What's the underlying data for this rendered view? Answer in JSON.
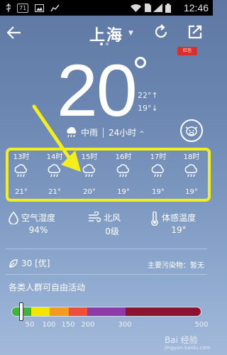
{
  "status_bar": {
    "notification_badge": "71",
    "time": "12:46",
    "icons": [
      "usb-icon",
      "notification-71",
      "image-icon",
      "chart-icon",
      "wifi-icon",
      "sd-card-icon",
      "signal-icon",
      "battery-icon"
    ]
  },
  "header": {
    "back_icon": "arrow-left-icon",
    "city": "上海",
    "dropdown_icon": "caret-down-icon",
    "refresh_icon": "refresh-icon",
    "share_icon": "share-icon",
    "badge_text": "红包"
  },
  "current": {
    "temperature": "20",
    "high": "22°↑",
    "low": "19°↓",
    "condition": "中雨",
    "forecast_toggle": "24小时",
    "mascot_icon": "cow-mascot-icon"
  },
  "hourly": [
    {
      "time": "13时",
      "temp": "21°",
      "icon": "rain-icon"
    },
    {
      "time": "14时",
      "temp": "21°",
      "icon": "rain-icon"
    },
    {
      "time": "15时",
      "temp": "20°",
      "icon": "rain-icon"
    },
    {
      "time": "16时",
      "temp": "19°",
      "icon": "rain-icon"
    },
    {
      "time": "17时",
      "temp": "19°",
      "icon": "rain-icon"
    },
    {
      "time": "18时",
      "temp": "19°",
      "icon": "rain-icon"
    }
  ],
  "details": {
    "humidity": {
      "label": "空气湿度",
      "value": "94%",
      "icon": "droplet-icon"
    },
    "wind": {
      "label": "北风",
      "value": "0级",
      "icon": "wind-icon"
    },
    "feels_like": {
      "label": "体感温度",
      "value": "19°",
      "icon": "thermometer-icon"
    }
  },
  "air": {
    "aqi": "30 [优]",
    "icon": "leaf-icon",
    "pollutant": "主要污染物：暂无",
    "activity": "各类人群可自由活动",
    "aqi_value": 30,
    "scale_ticks": [
      "50",
      "100",
      "150",
      "200",
      "300",
      "500"
    ],
    "scale_colors": [
      "#3fb33a",
      "#f2e600",
      "#f59a1e",
      "#ee4e3a",
      "#8f3aa5",
      "#8b1430"
    ]
  },
  "watermark": {
    "brand": "Bai 经验",
    "url": "jingyan.baidu.com"
  },
  "colors": {
    "highlight": "#f4ee1b",
    "background_top": "#5e78a3",
    "background_bottom": "#a2b9da"
  }
}
